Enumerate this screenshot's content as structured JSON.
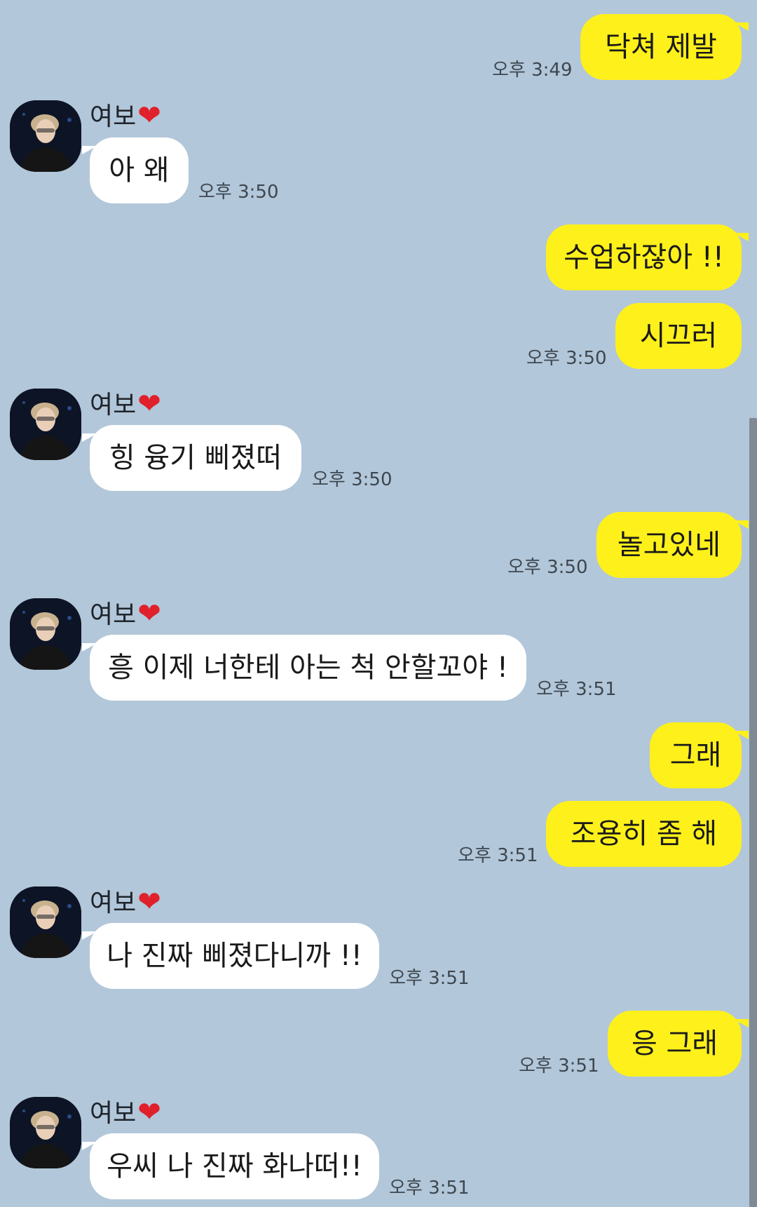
{
  "contact": {
    "name": "여보",
    "name_emoji": "❤"
  },
  "messages": [
    {
      "id": "m1",
      "from": "me",
      "text": "닥쳐 제발",
      "time": "오후 3:49"
    },
    {
      "id": "m2",
      "from": "them",
      "text": "아 왜",
      "time": "오후 3:50"
    },
    {
      "id": "m3",
      "from": "me",
      "text": "수업하잖아 !!",
      "time": ""
    },
    {
      "id": "m4",
      "from": "me",
      "text": "시끄러",
      "time": "오후 3:50"
    },
    {
      "id": "m5",
      "from": "them",
      "text": "힝 융기 삐졌떠",
      "time": "오후 3:50"
    },
    {
      "id": "m6",
      "from": "me",
      "text": "놀고있네",
      "time": "오후 3:50"
    },
    {
      "id": "m7",
      "from": "them",
      "text": "흥 이제 너한테 아는 척 안할꼬야 !",
      "time": "오후 3:51"
    },
    {
      "id": "m8",
      "from": "me",
      "text": "그래",
      "time": ""
    },
    {
      "id": "m9",
      "from": "me",
      "text": "조용히 좀 해",
      "time": "오후 3:51"
    },
    {
      "id": "m10",
      "from": "them",
      "text": "나 진짜 삐졌다니까 !!",
      "time": "오후 3:51"
    },
    {
      "id": "m11",
      "from": "me",
      "text": "응 그래",
      "time": "오후 3:51"
    },
    {
      "id": "m12",
      "from": "them",
      "text": "우씨 나 진짜 화나떠!!",
      "time": "오후 3:51"
    }
  ],
  "colors": {
    "background": "#b2c7d9",
    "my_bubble": "#fef01b",
    "their_bubble": "#ffffff",
    "heart": "#e0202a"
  }
}
